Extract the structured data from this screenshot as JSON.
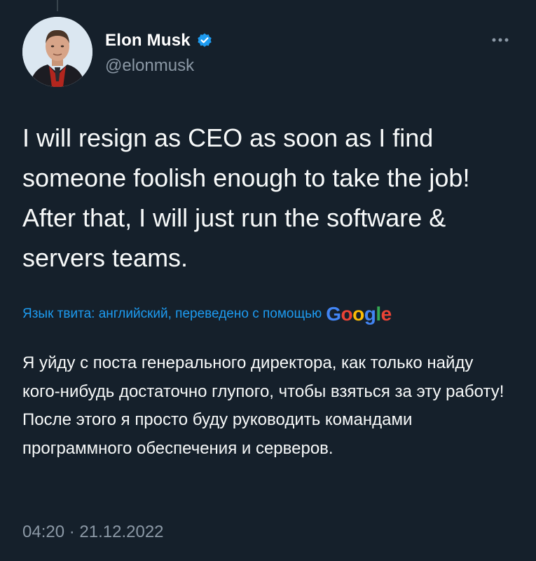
{
  "author": {
    "display_name": "Elon Musk",
    "handle": "@elonmusk",
    "verified": true,
    "avatar_icon": "profile-photo"
  },
  "tweet": {
    "text": "I will resign as CEO as soon as I find someone foolish enough to take the job! After that, I will just run the software & servers teams.",
    "translation_label": "Язык твита: английский, переведено с помощью",
    "translation_provider": "Google",
    "translated_text": "Я уйду с поста генерального директора, как только найду кого-нибудь достаточно глупого, чтобы взяться за эту работу! После этого я просто буду руководить командами программного обеспечения и серверов.",
    "time": "04:20",
    "separator": "·",
    "date": "21.12.2022"
  },
  "colors": {
    "background": "#15202b",
    "text": "#f7f9f9",
    "secondary_text": "#8b98a5",
    "accent": "#1d9bf0"
  }
}
